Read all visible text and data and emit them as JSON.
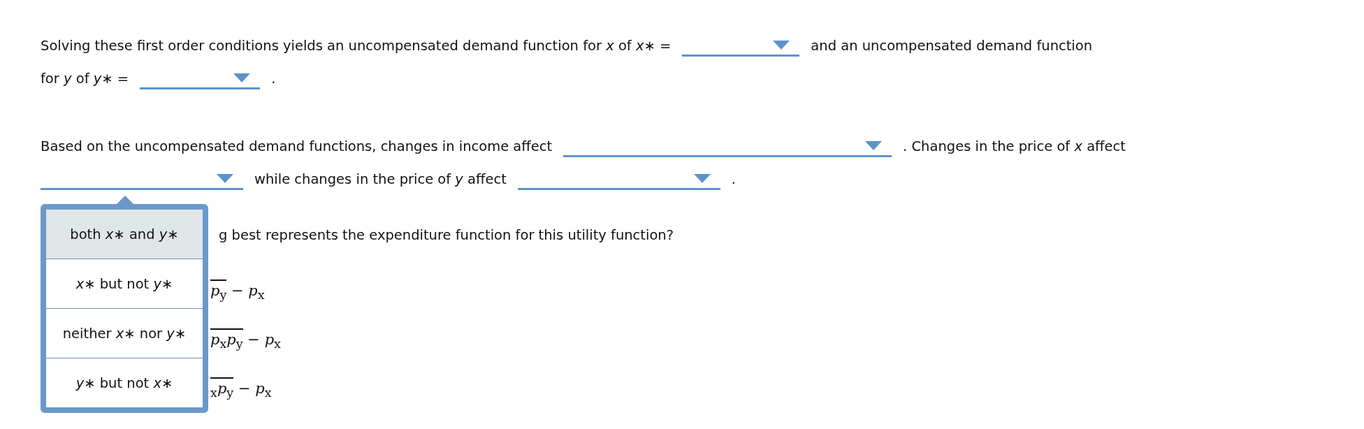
{
  "paragraphs": [
    {
      "lines": [
        [
          {
            "kind": "text",
            "text": "Solving these first order conditions yields an uncompensated demand function for *x* of *x*∗ ="
          },
          {
            "kind": "dropdown"
          },
          {
            "kind": "text",
            "text": "and an uncompensated demand function"
          }
        ],
        [
          {
            "kind": "text",
            "text": "for *y* of *y*∗ ="
          },
          {
            "kind": "dropdown"
          },
          {
            "kind": "text",
            "text": "."
          }
        ]
      ]
    },
    {
      "lines": [
        [
          {
            "kind": "text",
            "text": "Based on the uncompensated demand functions, changes in income affect"
          },
          {
            "kind": "dropdown"
          },
          {
            "kind": "text",
            "text": ". Changes in the price of *x* affect"
          }
        ],
        [
          {
            "kind": "dropdown",
            "open": true,
            "options": [
              {
                "text": "both *x*∗ and *y*∗",
                "selected": true
              },
              {
                "text": "*x*∗ but not *y*∗",
                "selected": false
              },
              {
                "text": "neither *x*∗ nor *y*∗",
                "selected": false
              },
              {
                "text": "*y*∗ but not *x*∗",
                "selected": false
              }
            ]
          },
          {
            "kind": "text",
            "text": "while changes in the price of *y* affect"
          },
          {
            "kind": "dropdown"
          },
          {
            "kind": "text",
            "text": "."
          }
        ]
      ]
    }
  ],
  "question": {
    "text": "g best represents the expenditure function for this utility function?",
    "answers": [
      {
        "under_root": "*p*$_{y}$",
        "rest": " − *p*$_{x}$"
      },
      {
        "under_root": "*p*$_{x}$*p*$_{y}$",
        "rest": " − *p*$_{x}$"
      },
      {
        "under_root": "$_{x}$*p*$_{y}$",
        "rest": " − *p*$_{x}$"
      }
    ]
  }
}
